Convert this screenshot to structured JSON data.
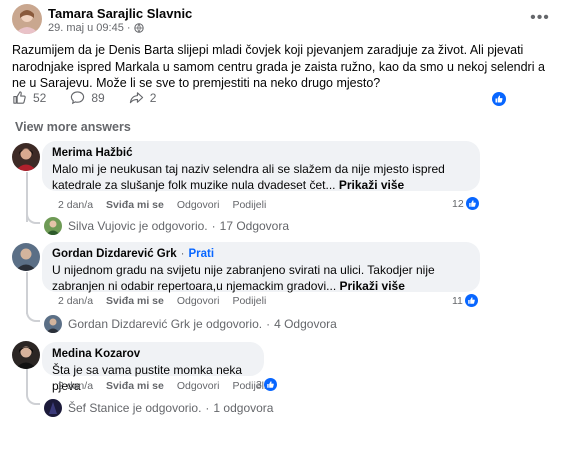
{
  "post": {
    "author": "Tamara Sarajlic Slavnic",
    "date": "29. maj u 09:45 ·",
    "text": "Razumijem da je Denis Barta slijepi mladi čovjek koji pjevanjem zaradjuje za život. Ali pjevati narodnjake ispred Markala u samom centru grada je zaista ružno, kao da smo u nekoj selendri a ne u Sarajevu. Može li se sve to premjestiti na neko drugo mjesto?",
    "likes": "52",
    "comments": "89",
    "shares": "2"
  },
  "view_more": "View more answers",
  "comments": [
    {
      "author": "Merima Hažbić",
      "text": "Malo mi je neukusan taj naziv selendra ali se slažem da nije mjesto ispred katedrale za slušanje folk muzike nula dvadeset čet",
      "see_more": "Prikaži više",
      "time": "2 dan/a",
      "like": "Sviđa mi se",
      "reply": "Odgovori",
      "share": "Podijeli",
      "count": "12",
      "reply_summary_name": "Silva Vujovic je odgovorio.",
      "reply_summary_count": "17 Odgovora"
    },
    {
      "author": "Gordan Dizdarević Grk",
      "follow": "Prati",
      "text": "U nijednom gradu na svijetu nije zabranjeno svirati na ulici. Takodjer nije zabranjen ni odabir repertoara,u njemackim gradovi",
      "see_more": "Prikaži više",
      "time": "2 dan/a",
      "like": "Sviđa mi se",
      "reply": "Odgovori",
      "share": "Podijeli",
      "count": "11",
      "reply_summary_name": "Gordan Dizdarević Grk je odgovorio.",
      "reply_summary_count": "4 Odgovora"
    },
    {
      "author": "Medina Kozarov",
      "text": "Šta je sa vama pustite momka neka pjeva",
      "time": "2 dan/a",
      "like": "Sviđa mi se",
      "reply": "Odgovori",
      "share": "Podijeli",
      "count": "3",
      "reply_summary_name": "Šef Stanice je odgovorio.",
      "reply_summary_count": "1 odgovora"
    }
  ],
  "colors": {
    "accent": "#0866ff",
    "secondary_text": "#65676b",
    "bubble": "#f0f2f5"
  },
  "icons": [
    "globe-icon",
    "more-icon",
    "like-icon",
    "comment-icon",
    "share-icon",
    "like-badge-icon"
  ]
}
